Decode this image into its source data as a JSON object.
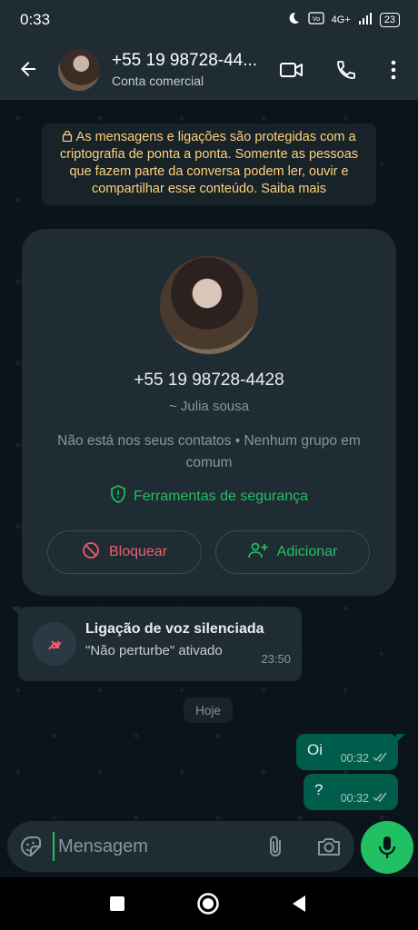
{
  "status": {
    "time": "0:33",
    "network": "4G+",
    "battery": "23"
  },
  "header": {
    "title": "+55 19 98728-44...",
    "subtitle": "Conta comercial"
  },
  "encryption_notice": "As mensagens e ligações são protegidas com a criptografia de ponta a ponta. Somente as pessoas que fazem parte da conversa podem ler, ouvir e compartilhar esse conteúdo. Saiba mais",
  "profile_card": {
    "phone": "+55 19 98728-4428",
    "alias": "~ Julia sousa",
    "info": "Não está nos seus contatos • Nenhum grupo em comum",
    "security_link": "Ferramentas de segurança",
    "block_label": "Bloquear",
    "add_label": "Adicionar"
  },
  "call_message": {
    "title": "Ligação de voz silenciada",
    "subtitle": "\"Não perturbe\" ativado",
    "time": "23:50"
  },
  "date_chip": "Hoje",
  "messages": [
    {
      "text": "Oi",
      "time": "00:32",
      "status": "delivered"
    },
    {
      "text": "?",
      "time": "00:32",
      "status": "delivered"
    }
  ],
  "composer": {
    "placeholder": "Mensagem"
  },
  "colors": {
    "accent": "#21c063",
    "danger": "#f15c6d",
    "outgoing": "#005c4b",
    "warning_text": "#ffd279"
  },
  "icons": [
    "back-arrow-icon",
    "video-call-icon",
    "phone-icon",
    "more-vert-icon",
    "lock-icon",
    "shield-icon",
    "block-icon",
    "person-add-icon",
    "missed-call-icon",
    "double-check-icon",
    "sticker-icon",
    "attach-icon",
    "camera-icon",
    "mic-icon"
  ]
}
